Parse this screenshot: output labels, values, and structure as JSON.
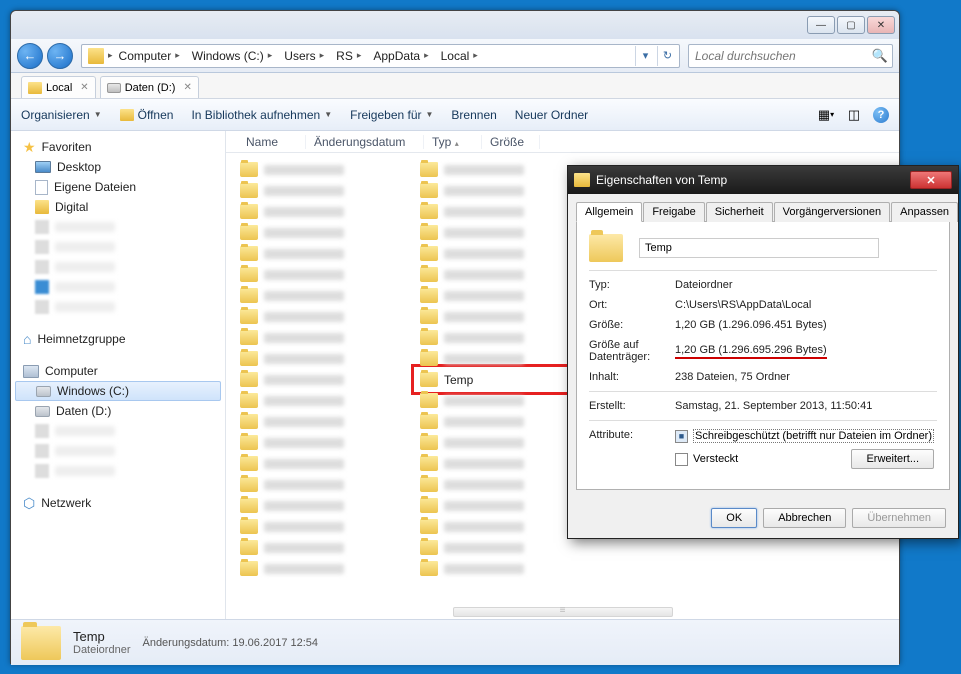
{
  "titlebar": {
    "min": "—",
    "max": "▢",
    "close": "✕"
  },
  "nav": {
    "backArrow": "←",
    "fwdArrow": "→"
  },
  "breadcrumbs": [
    "Computer",
    "Windows (C:)",
    "Users",
    "RS",
    "AppData",
    "Local"
  ],
  "search": {
    "placeholder": "Local durchsuchen",
    "icon": "🔍"
  },
  "tabs": [
    {
      "label": "Local",
      "type": "folder"
    },
    {
      "label": "Daten (D:)",
      "type": "drive"
    }
  ],
  "toolbar": {
    "organize": "Organisieren",
    "open": "Öffnen",
    "library": "In Bibliothek aufnehmen",
    "share": "Freigeben für",
    "burn": "Brennen",
    "newfolder": "Neuer Ordner"
  },
  "columns": {
    "name": "Name",
    "date": "Änderungsdatum",
    "type": "Typ",
    "size": "Größe"
  },
  "sidebar": {
    "favorites": "Favoriten",
    "desktop": "Desktop",
    "owndocs": "Eigene Dateien",
    "digital": "Digital",
    "homegroup": "Heimnetzgruppe",
    "computer": "Computer",
    "winc": "Windows (C:)",
    "datend": "Daten (D:)",
    "network": "Netzwerk"
  },
  "highlighted_folder": "Temp",
  "status": {
    "title": "Temp",
    "sub": "Dateiordner",
    "meta_label": "Änderungsdatum:",
    "meta_value": "19.06.2017 12:54"
  },
  "dialog": {
    "title": "Eigenschaften von Temp",
    "tabs": [
      "Allgemein",
      "Freigabe",
      "Sicherheit",
      "Vorgängerversionen",
      "Anpassen"
    ],
    "name": "Temp",
    "rows": {
      "type_lbl": "Typ:",
      "type_val": "Dateiordner",
      "loc_lbl": "Ort:",
      "loc_val": "C:\\Users\\RS\\AppData\\Local",
      "size_lbl": "Größe:",
      "size_val": "1,20 GB (1.296.096.451 Bytes)",
      "disk_lbl": "Größe auf Datenträger:",
      "disk_val": "1,20 GB (1.296.695.296 Bytes)",
      "cont_lbl": "Inhalt:",
      "cont_val": "238 Dateien, 75 Ordner",
      "created_lbl": "Erstellt:",
      "created_val": "Samstag, 21. September 2013, 11:50:41",
      "attr_lbl": "Attribute:",
      "attr_ro": "Schreibgeschützt (betrifft nur Dateien im Ordner)",
      "attr_hidden": "Versteckt",
      "advanced": "Erweitert..."
    },
    "buttons": {
      "ok": "OK",
      "cancel": "Abbrechen",
      "apply": "Übernehmen"
    }
  }
}
